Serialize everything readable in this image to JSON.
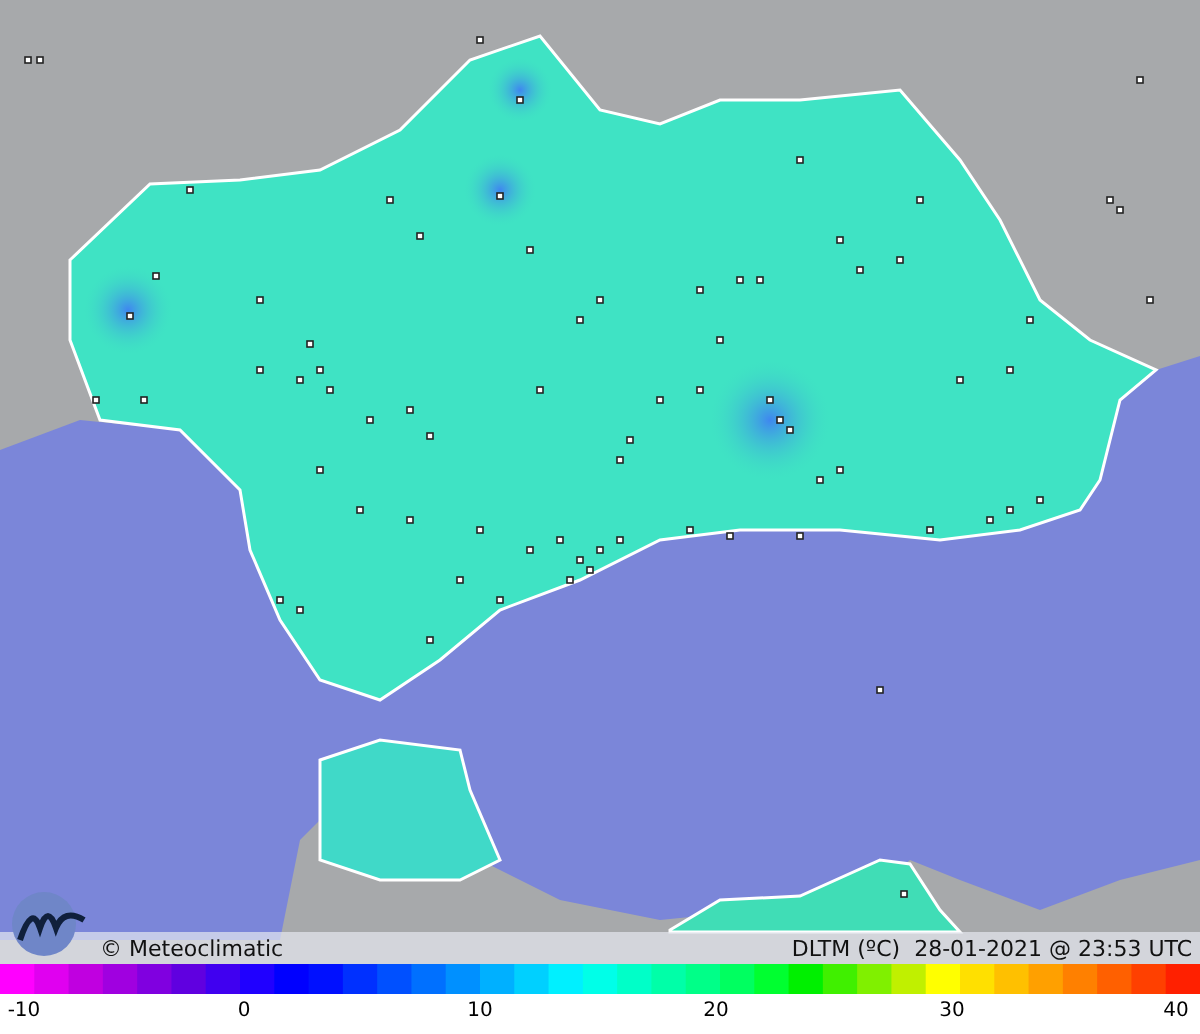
{
  "map": {
    "credit": "© Meteoclimatic",
    "caption": "DLTM (ºC)  28-01-2021 @ 23:53 UTC"
  },
  "legend": {
    "ticks": [
      "-10",
      "0",
      "10",
      "20",
      "30",
      "40"
    ]
  }
}
